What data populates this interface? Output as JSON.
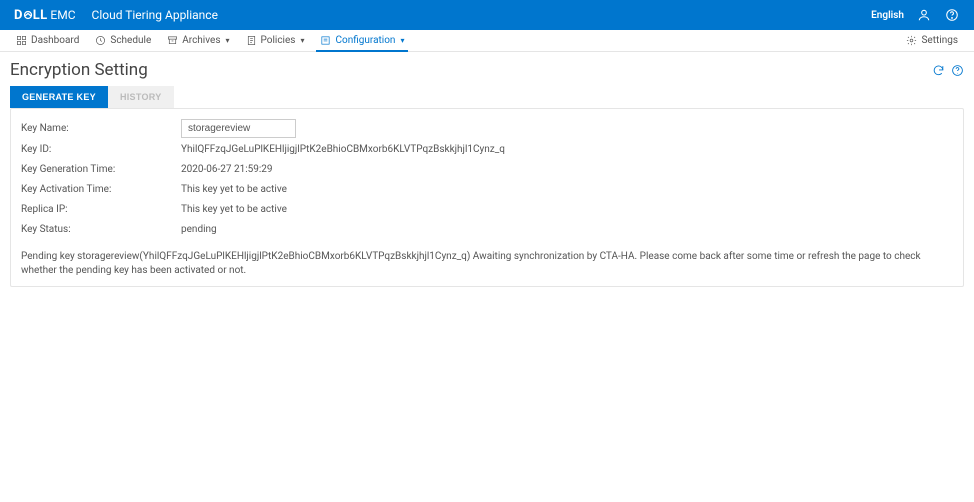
{
  "topbar": {
    "brand_main": "D",
    "brand_tail": "LL",
    "brand_emc": "EMC",
    "product": "Cloud Tiering Appliance",
    "language": "English"
  },
  "nav": {
    "items": [
      {
        "label": "Dashboard"
      },
      {
        "label": "Schedule"
      },
      {
        "label": "Archives"
      },
      {
        "label": "Policies"
      },
      {
        "label": "Configuration"
      }
    ],
    "settings": "Settings"
  },
  "page": {
    "title": "Encryption Setting"
  },
  "tabs": {
    "generate": "GENERATE KEY",
    "history": "HISTORY"
  },
  "form": {
    "key_name_label": "Key Name:",
    "key_name_value": "storagereview",
    "key_id_label": "Key ID:",
    "key_id_value": "YhilQFFzqJGeLuPlKEHljigjlPtK2eBhioCBMxorb6KLVTPqzBskkjhjl1Cynz_q",
    "gen_time_label": "Key Generation Time:",
    "gen_time_value": "2020-06-27 21:59:29",
    "act_time_label": "Key Activation Time:",
    "act_time_value": "This key yet to be active",
    "replica_label": "Replica IP:",
    "replica_value": "This key yet to be active",
    "status_label": "Key Status:",
    "status_value": "pending",
    "message": "Pending key storagereview(YhilQFFzqJGeLuPlKEHljigjlPtK2eBhioCBMxorb6KLVTPqzBskkjhjl1Cynz_q) Awaiting synchronization by CTA-HA. Please come back after some time or refresh the page to check whether the pending key has been activated or not."
  }
}
